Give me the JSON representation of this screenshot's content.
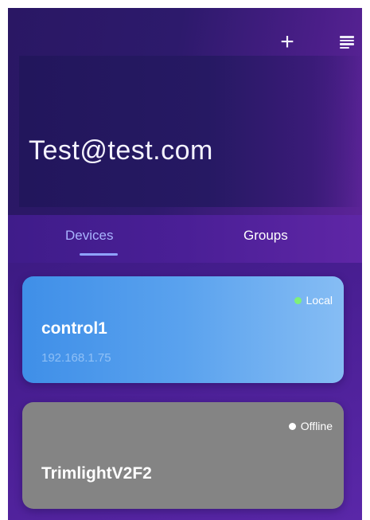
{
  "account": {
    "email": "Test@test.com"
  },
  "toolbar": {
    "add_icon": "+",
    "add_icon_name": "plus-icon",
    "menu_icon_name": "menu-icon"
  },
  "tabs": [
    {
      "label": "Devices",
      "active": true
    },
    {
      "label": "Groups",
      "active": false
    }
  ],
  "devices": [
    {
      "name": "control1",
      "status": "Local",
      "ip": "192.168.1.75",
      "status_color": "#7ff07a",
      "card_color": "#5aa2ee"
    },
    {
      "name": "TrimlightV2F2",
      "status": "Offline",
      "status_color": "#ffffff",
      "card_color": "#848484"
    }
  ],
  "colors": {
    "background": "#3a1a80",
    "active_tab": "#a9b4ff"
  }
}
